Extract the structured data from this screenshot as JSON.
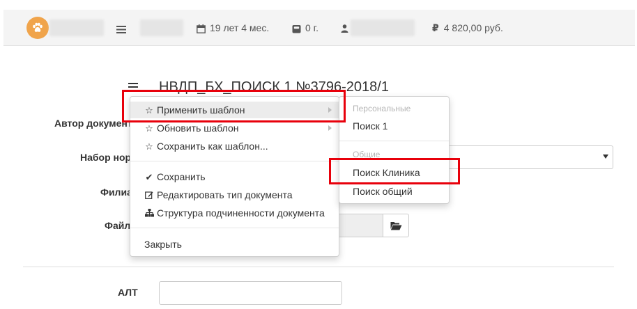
{
  "topbar": {
    "age_text": "19 лет 4 мес.",
    "experience_text": "0 г.",
    "balance_text": "4 820,00 руб."
  },
  "document": {
    "title": "НВДП_БХ_ПОИСК 1 №3796-2018/1"
  },
  "form": {
    "author_label": "Автор документа",
    "norm_set_label": "Набор нор",
    "branch_label": "Филиа",
    "file_label": "Файл",
    "alt_label": "АЛТ"
  },
  "context_menu": {
    "apply_template": "Применить шаблон",
    "update_template": "Обновить шаблон",
    "save_as_template": "Сохранить как шаблон...",
    "save": "Сохранить",
    "edit_doc_type": "Редактировать тип документа",
    "doc_structure": "Структура подчиненности документа",
    "close": "Закрыть"
  },
  "submenu": {
    "personal_header": "Персональные",
    "personal_items": [
      "Поиск 1"
    ],
    "common_header": "Общие",
    "common_items": [
      "Поиск Клиника",
      "Поиск общий"
    ]
  },
  "colors": {
    "avatar": "#f0a44b",
    "highlight": "#e8000b",
    "menu_active": "#ececec"
  }
}
